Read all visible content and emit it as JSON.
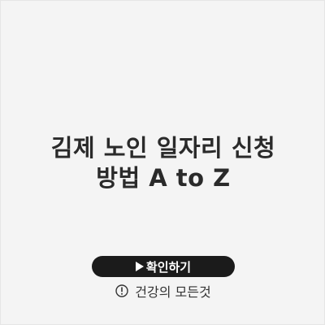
{
  "page": {
    "title_line1": "김제 노인 일자리 신청",
    "title_line2": "방법 A to Z",
    "confirm_button_label": "확인하기",
    "footer_text": "건강의 모든것"
  },
  "icons": {
    "button_icon": "play-icon",
    "footer_icon": "exclamation-icon"
  },
  "colors": {
    "background": "#f4f4f4",
    "title": "#2a2a2a",
    "button_background": "#1b1b1b",
    "button_text": "#ffffff"
  }
}
